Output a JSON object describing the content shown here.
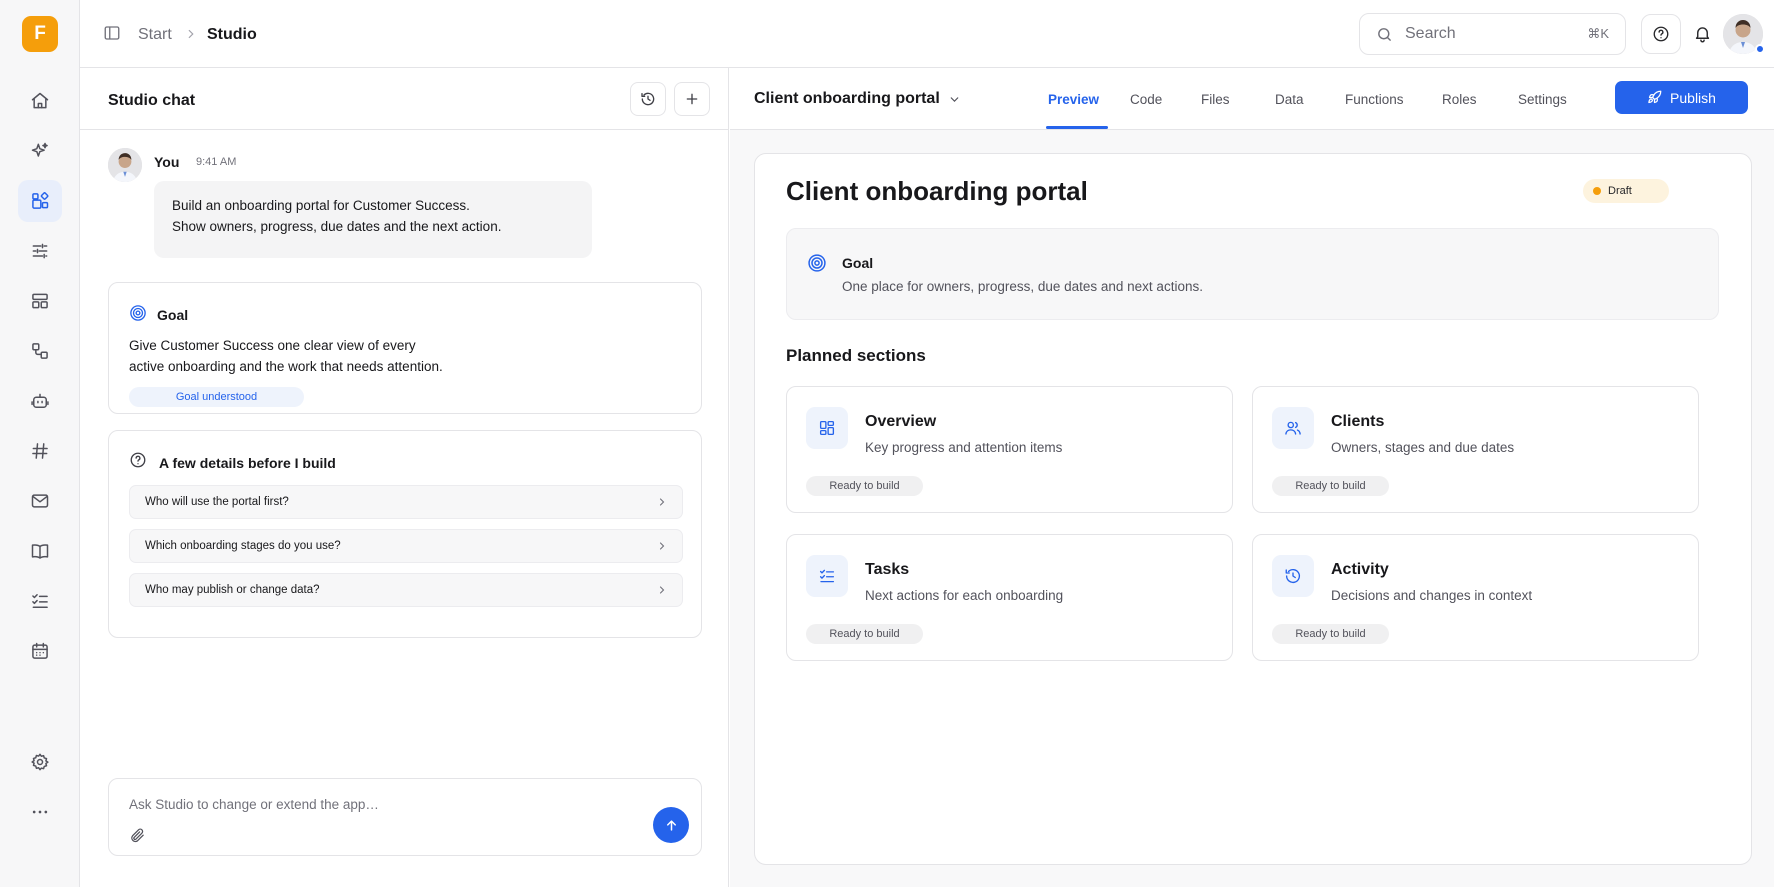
{
  "app": {
    "logo_letter": "F",
    "accent": "#2563eb",
    "brand": "#f59e0b"
  },
  "rail": {
    "items": [
      {
        "icon": "home-icon"
      },
      {
        "icon": "sparkles-icon"
      },
      {
        "icon": "apps-icon",
        "active": true
      },
      {
        "icon": "sliders-icon"
      },
      {
        "icon": "layout-icon"
      },
      {
        "icon": "workflow-icon"
      },
      {
        "icon": "bot-icon"
      },
      {
        "icon": "hash-icon"
      },
      {
        "icon": "mail-icon"
      },
      {
        "icon": "book-icon"
      },
      {
        "icon": "checklist-icon"
      },
      {
        "icon": "calendar-icon"
      },
      {
        "icon": "gear-icon"
      },
      {
        "icon": "more-icon"
      }
    ]
  },
  "topbar": {
    "breadcrumb": {
      "start": "Start",
      "current": "Studio"
    },
    "search": {
      "placeholder": "Search",
      "shortcut": "⌘K"
    }
  },
  "chat": {
    "title": "Studio chat",
    "message": {
      "author": "You",
      "time": "9:41 AM",
      "lines": [
        "Build an onboarding portal for Customer Success.",
        "Show owners, progress, due dates and the next action."
      ]
    },
    "goal": {
      "title": "Goal",
      "lines": [
        "Give Customer Success one clear view of every",
        "active onboarding and the work that needs attention."
      ],
      "badge": "Goal understood"
    },
    "details": {
      "title": "A few details before I build",
      "questions": [
        "Who will use the portal first?",
        "Which onboarding stages do you use?",
        "Who may publish or change data?"
      ]
    },
    "composer": {
      "placeholder": "Ask Studio to change or extend the app…"
    }
  },
  "preview": {
    "app_title": "Client onboarding portal",
    "tabs": [
      "Preview",
      "Code",
      "Files",
      "Data",
      "Functions",
      "Roles",
      "Settings"
    ],
    "active_tab": "Preview",
    "publish_label": "Publish",
    "canvas": {
      "title": "Client onboarding portal",
      "status": "Draft",
      "goal": {
        "title": "Goal",
        "text": "One place for owners, progress, due dates and next actions."
      },
      "sections_title": "Planned sections",
      "sections": [
        {
          "icon": "dashboard-icon",
          "title": "Overview",
          "desc": "Key progress and attention items",
          "badge": "Ready to build"
        },
        {
          "icon": "users-icon",
          "title": "Clients",
          "desc": "Owners, stages and due dates",
          "badge": "Ready to build"
        },
        {
          "icon": "task-list-icon",
          "title": "Tasks",
          "desc": "Next actions for each onboarding",
          "badge": "Ready to build"
        },
        {
          "icon": "history-icon",
          "title": "Activity",
          "desc": "Decisions and changes in context",
          "badge": "Ready to build"
        }
      ]
    }
  }
}
